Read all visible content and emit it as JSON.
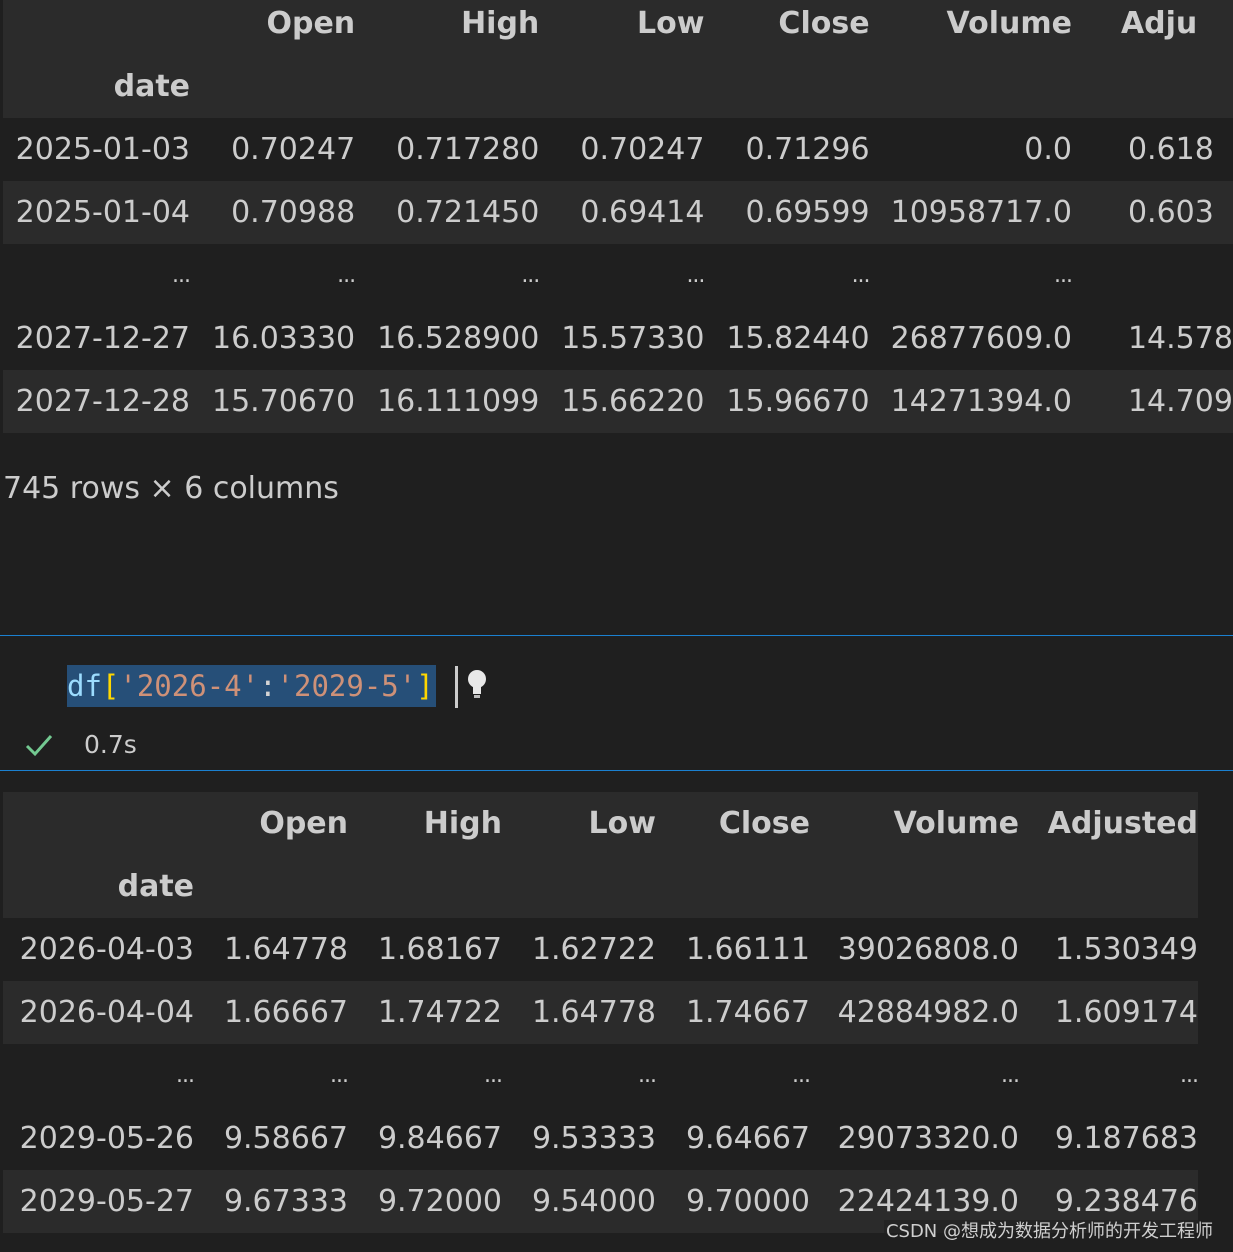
{
  "top_table": {
    "index_name": "date",
    "columns": [
      "Open",
      "High",
      "Low",
      "Close",
      "Volume",
      "Adju"
    ],
    "rows": [
      [
        "2025-01-03",
        "0.70247",
        "0.717280",
        "0.70247",
        "0.71296",
        "0.0",
        "0.618"
      ],
      [
        "2025-01-04",
        "0.70988",
        "0.721450",
        "0.69414",
        "0.69599",
        "10958717.0",
        "0.603"
      ],
      [
        "...",
        "...",
        "...",
        "...",
        "...",
        "...",
        ""
      ],
      [
        "2027-12-27",
        "16.03330",
        "16.528900",
        "15.57330",
        "15.82440",
        "26877609.0",
        "14.578"
      ],
      [
        "2027-12-28",
        "15.70670",
        "16.111099",
        "15.66220",
        "15.96670",
        "14271394.0",
        "14.709"
      ]
    ],
    "shape": "745 rows × 6 columns"
  },
  "code_cell": {
    "code_tokens": [
      {
        "t": "df",
        "c": "var"
      },
      {
        "t": "[",
        "c": "brk"
      },
      {
        "t": "'2026-4'",
        "c": "str"
      },
      {
        "t": ":",
        "c": "pun"
      },
      {
        "t": "'2029-5'",
        "c": "str"
      },
      {
        "t": "]",
        "c": "brk"
      }
    ],
    "status": "success",
    "exec_time": "0.7s",
    "border_color": "#1b80d0",
    "selection_color": "#264f78"
  },
  "bottom_table": {
    "index_name": "date",
    "columns": [
      "Open",
      "High",
      "Low",
      "Close",
      "Volume",
      "Adjusted"
    ],
    "rows": [
      [
        "2026-04-03",
        "1.64778",
        "1.68167",
        "1.62722",
        "1.66111",
        "39026808.0",
        "1.530349"
      ],
      [
        "2026-04-04",
        "1.66667",
        "1.74722",
        "1.64778",
        "1.74667",
        "42884982.0",
        "1.609174"
      ],
      [
        "...",
        "...",
        "...",
        "...",
        "...",
        "...",
        "..."
      ],
      [
        "2029-05-26",
        "9.58667",
        "9.84667",
        "9.53333",
        "9.64667",
        "29073320.0",
        "9.187683"
      ],
      [
        "2029-05-27",
        "9.67333",
        "9.72000",
        "9.54000",
        "9.70000",
        "22424139.0",
        "9.238476"
      ]
    ]
  },
  "watermark": "CSDN @想成为数据分析师的开发工程师",
  "colors": {
    "background": "#1f1f1f",
    "header_row": "#2b2b2b",
    "text": "#cccccc",
    "check": "#73c991"
  }
}
